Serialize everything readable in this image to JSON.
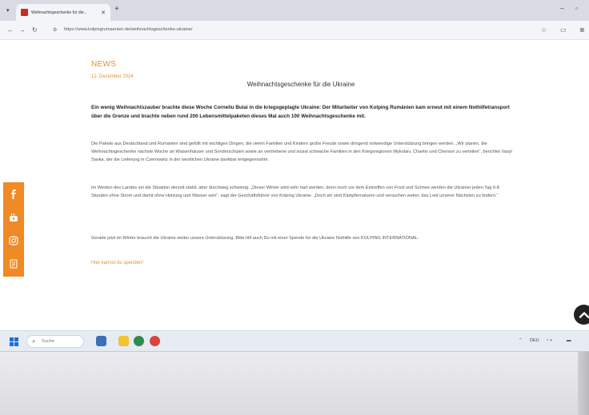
{
  "browser": {
    "tab_title": "Weihnachtsgeschenke für die...",
    "new_tab_symbol": "+",
    "close_symbol": "✕",
    "url": "https://www.kolpingrumaenien.de/weihnachtsgeschenke-ukraine/"
  },
  "article": {
    "section": "NEWS",
    "date": "12. Dezember 2024",
    "title": "Weihnachtsgeschenke für die Ukraine",
    "lead": "Ein wenig Weihnachtszauber brachte diese Woche Corneliu Bulai in die kriegsgeplagte Ukraine: Der Mitarbeiter von Kolping Rumänien kam erneut mit einem Nothilfetransport über die Grenze und brachte neben rund 200 Lebensmittelpaketen dieses Mal auch 100 Weihnachtsgeschenke mit.",
    "paragraphs": [
      "Die Pakete aus Deutschland und Rumänien sind gefüllt mit wichtigen Dingen, die vielen Familien und Kindern große Freude sowie dringend notwendige Unterstützung bringen werden. „Wir planen, die Weihnachtsgeschenke nächste Woche an Waisenhäuser und Sonderschulen sowie an vertriebene und sozial schwache Familien in den Kriegsregionen Mykolaiv, Charkiv und Cherson zu verteilen“, berichtet Vasyl Savka, der die Lieferung in Czernowitz in der westlichen Ukraine dankbar entgegennahm.",
      "Im Westen des Landes sei die Situation derzeit stabil, aber durchweg schwierig. „Dieser Winter wird sehr hart werden, denn noch vor dem Eintreffen von Frost und Schnee werden die Ukrainer jeden Tag 6-8 Stunden ohne Strom und damit ohne Heizung und Wasser sein“, sagt der Geschäftsführer von Kolping Ukraine. „Doch wir sind Kämpfernaturen und versuchen weiter, das Leid unserer Nächsten zu lindern.“",
      "Gerade jetzt im Winter braucht die Ukraine weiter unsere Unterstützung. Bitte hilf auch Du mit einer Spende für die Ukraine Nothilfe von KOLPING INTERNATIONAL."
    ],
    "cta": "Hier kannst du spenden!"
  },
  "taskbar": {
    "search_placeholder": "Suche",
    "tray_text": "DEU",
    "tray_sub": "DE"
  },
  "colors": {
    "accent": "#e8902e",
    "social_bg": "#f08a24"
  }
}
